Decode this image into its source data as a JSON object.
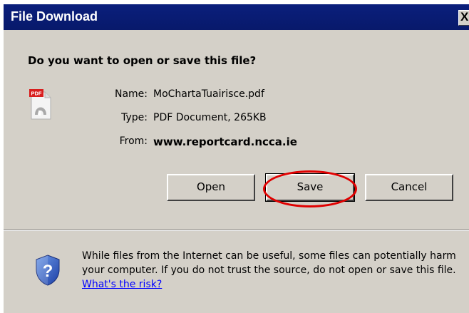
{
  "dialog": {
    "title": "File Download",
    "close_label": "X",
    "question": "Do you want to open or save this file?"
  },
  "file": {
    "name_label": "Name:",
    "name_value": "MoChartaTuairisce.pdf",
    "type_label": "Type:",
    "type_value": "PDF Document, 265KB",
    "from_label": "From:",
    "from_value": "www.reportcard.ncca.ie",
    "icon": "pdf-file-icon"
  },
  "buttons": {
    "open": "Open",
    "save": "Save",
    "cancel": "Cancel"
  },
  "warning": {
    "text": "While files from the Internet can be useful, some files can potentially harm your computer. If you do not trust the source, do not open or save this file.",
    "link": "What's the risk?",
    "icon": "security-shield-icon"
  },
  "annotation": {
    "highlight_color": "#e00000"
  },
  "colors": {
    "titlebar": "#0a1f7c",
    "dialog_bg": "#d4d0c8",
    "link": "#0000ff"
  }
}
